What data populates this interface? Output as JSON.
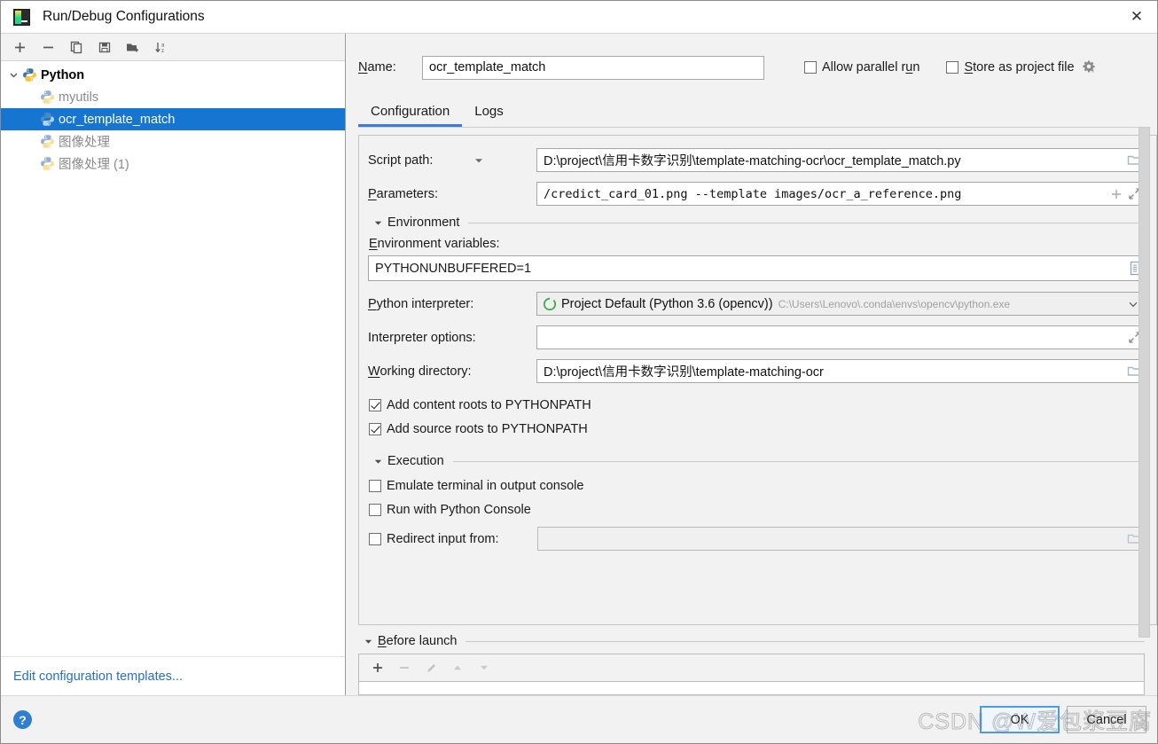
{
  "window": {
    "title": "Run/Debug Configurations",
    "app_icon": "pycharm-icon",
    "close_label": "✕"
  },
  "tree_toolbar": {
    "buttons": [
      {
        "name": "add-configuration-button",
        "icon": "plus-icon",
        "tooltip": "Add New Configuration"
      },
      {
        "name": "remove-configuration-button",
        "icon": "minus-icon",
        "tooltip": "Remove Configuration"
      },
      {
        "name": "copy-configuration-button",
        "icon": "copy-icon",
        "tooltip": "Copy Configuration"
      },
      {
        "name": "save-configuration-button",
        "icon": "save-icon",
        "tooltip": "Save Configuration"
      },
      {
        "name": "move-into-folder-button",
        "icon": "new-folder-icon",
        "tooltip": "Move into new folder"
      },
      {
        "name": "sort-configurations-button",
        "icon": "sort-alphabetically-icon",
        "tooltip": "Sort Configurations"
      }
    ]
  },
  "tree": {
    "group": {
      "label": "Python",
      "icon": "python-icon",
      "expanded": true,
      "chevron": "chevron-down-icon"
    },
    "items": [
      {
        "label": "myutils",
        "icon": "python-icon",
        "selected": false
      },
      {
        "label": "ocr_template_match",
        "icon": "python-icon",
        "selected": true
      },
      {
        "label": "图像处理",
        "icon": "python-icon",
        "selected": false
      },
      {
        "label": "图像处理 (1)",
        "icon": "python-icon",
        "selected": false
      }
    ]
  },
  "left_footer": {
    "edit_templates_link": "Edit configuration templates..."
  },
  "header": {
    "name_label": "Name:",
    "name_mnemonic": "N",
    "name_value": "ocr_template_match",
    "allow_parallel_run": {
      "label": "Allow parallel run",
      "checked": false,
      "mnemonic": "u"
    },
    "store_as_project_file": {
      "label": "Store as project file",
      "checked": false,
      "mnemonic": "S"
    },
    "gear_icon": "gear-dropdown-icon"
  },
  "tabs": [
    {
      "label": "Configuration",
      "active": true
    },
    {
      "label": "Logs",
      "active": false
    }
  ],
  "configuration": {
    "script_path": {
      "label": "Script path:",
      "value": "D:\\project\\信用卡数字识别\\template-matching-ocr\\ocr_template_match.py",
      "dropdown_icon": "chevron-down-icon",
      "browse_icon": "folder-icon"
    },
    "parameters": {
      "label": "Parameters:",
      "mnemonic": "P",
      "value": "/credict_card_01.png --template images/ocr_a_reference.png",
      "insert_macro_icon": "plus-icon",
      "expand_icon": "expand-icon"
    },
    "environment_section": {
      "title": "Environment",
      "expanded": true,
      "triangle_icon": "triangle-down-icon",
      "env_vars": {
        "label": "Environment variables:",
        "mnemonic": "E",
        "value": "PYTHONUNBUFFERED=1",
        "edit_icon": "edit-list-icon"
      },
      "python_interpreter": {
        "label": "Python interpreter:",
        "mnemonic": "P",
        "value": "Project Default (Python 3.6 (opencv))",
        "path": "C:\\Users\\Lenovo\\.conda\\envs\\opencv\\python.exe",
        "status_icon": "python-circle-icon",
        "dropdown_icon": "chevron-down-icon"
      },
      "interpreter_options": {
        "label": "Interpreter options:",
        "value": "",
        "expand_icon": "expand-icon"
      },
      "working_directory": {
        "label": "Working directory:",
        "mnemonic": "W",
        "value": "D:\\project\\信用卡数字识别\\template-matching-ocr",
        "browse_icon": "folder-icon"
      },
      "add_content_roots": {
        "label": "Add content roots to PYTHONPATH",
        "checked": true
      },
      "add_source_roots": {
        "label": "Add source roots to PYTHONPATH",
        "checked": true
      }
    },
    "execution_section": {
      "title": "Execution",
      "expanded": true,
      "triangle_icon": "triangle-down-icon",
      "emulate_terminal": {
        "label": "Emulate terminal in output console",
        "checked": false
      },
      "run_with_python_console": {
        "label": "Run with Python Console",
        "checked": false
      },
      "redirect_input": {
        "label": "Redirect input from:",
        "checked": false,
        "value": "",
        "browse_icon": "folder-icon"
      }
    }
  },
  "before_launch": {
    "title": "Before launch",
    "mnemonic": "B",
    "expanded": true,
    "triangle_icon": "triangle-down-icon",
    "toolbar": [
      {
        "name": "before-launch-add-button",
        "icon": "plus-icon",
        "disabled": false
      },
      {
        "name": "before-launch-remove-button",
        "icon": "minus-icon",
        "disabled": true
      },
      {
        "name": "before-launch-edit-button",
        "icon": "pencil-icon",
        "disabled": true
      },
      {
        "name": "before-launch-move-up-button",
        "icon": "triangle-up-icon",
        "disabled": true
      },
      {
        "name": "before-launch-move-down-button",
        "icon": "triangle-down-icon",
        "disabled": true
      }
    ]
  },
  "footer": {
    "help_label": "?",
    "ok_label": "OK",
    "cancel_label": "Cancel"
  },
  "watermark": {
    "text": "CSDN @W爱包浆豆腐"
  },
  "colors": {
    "selection_blue": "#1675d1",
    "accent_blue": "#2470c4",
    "tab_indicator": "#3d7dd8",
    "primary_button_border": "#4a9ae8",
    "help_blue": "#2f7fd1",
    "dialog_bg": "#f2f2f2",
    "panel_white": "#ffffff",
    "muted_text": "#8a8a8a"
  }
}
